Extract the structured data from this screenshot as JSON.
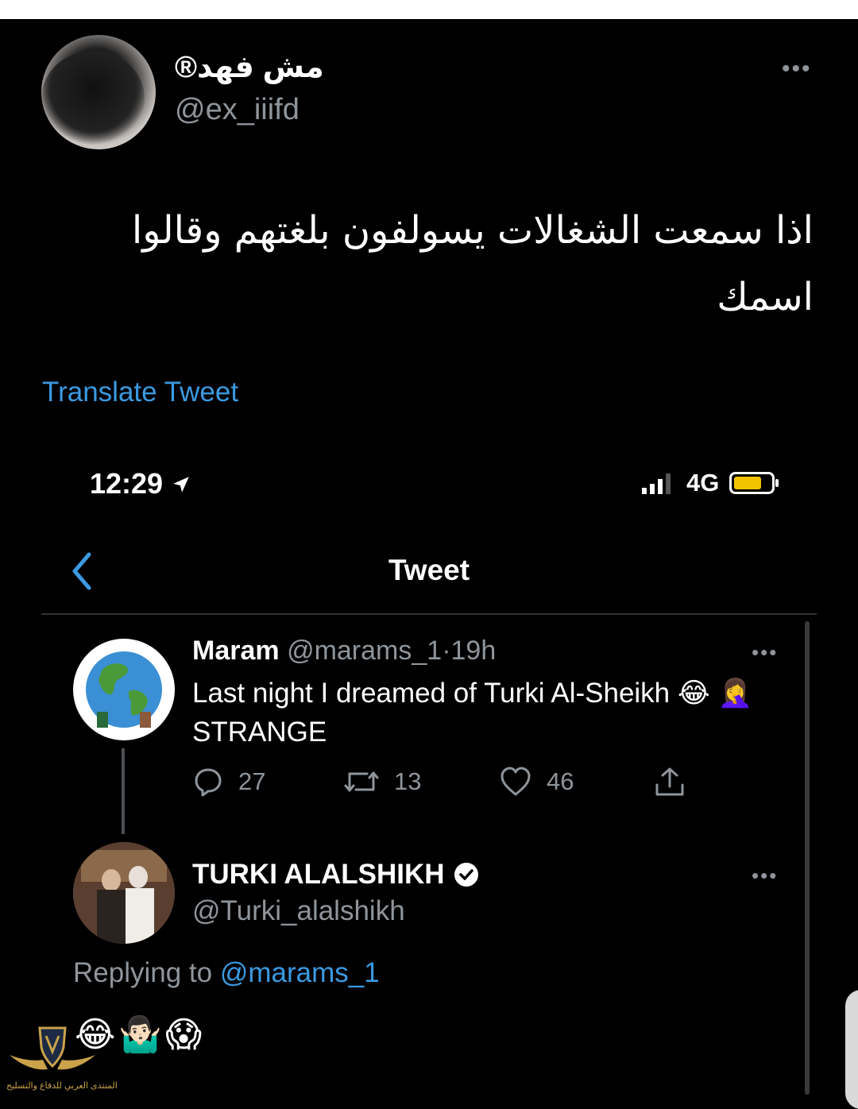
{
  "tweet": {
    "display_name": "مش فهد®",
    "handle": "@ex_iiifd",
    "text": "اذا سمعت الشغالات يسولفون بلغتهم وقالوا اسمك",
    "translate_label": "Translate Tweet"
  },
  "status_bar": {
    "time": "12:29",
    "network": "4G",
    "battery_color": "#f2c400"
  },
  "nav": {
    "title": "Tweet"
  },
  "original": {
    "name": "Maram",
    "handle": "@marams_1",
    "sep": "·",
    "age": "19h",
    "text": "Last night I dreamed of Turki Al-Sheikh 😂 🤦‍♀️ STRANGE",
    "replies": "27",
    "retweets": "13",
    "likes": "46"
  },
  "reply": {
    "name": "TURKI ALALSHIKH",
    "handle": "@Turki_alalshikh",
    "replying_prefix": "Replying to",
    "replying_mention": "@marams_1",
    "text": "😂🤷🏻‍♂️😱"
  },
  "watermark": {
    "text": "المنتدى العربي للدفاع والتسليح"
  },
  "colors": {
    "accent": "#3b9ae1",
    "muted": "#8e959b",
    "background": "#000000"
  },
  "icons": [
    "more-icon",
    "location-arrow-icon",
    "signal-icon",
    "battery-icon",
    "back-chevron-icon",
    "earth-icon",
    "reply-icon",
    "retweet-icon",
    "like-icon",
    "share-icon",
    "verified-badge-icon"
  ]
}
